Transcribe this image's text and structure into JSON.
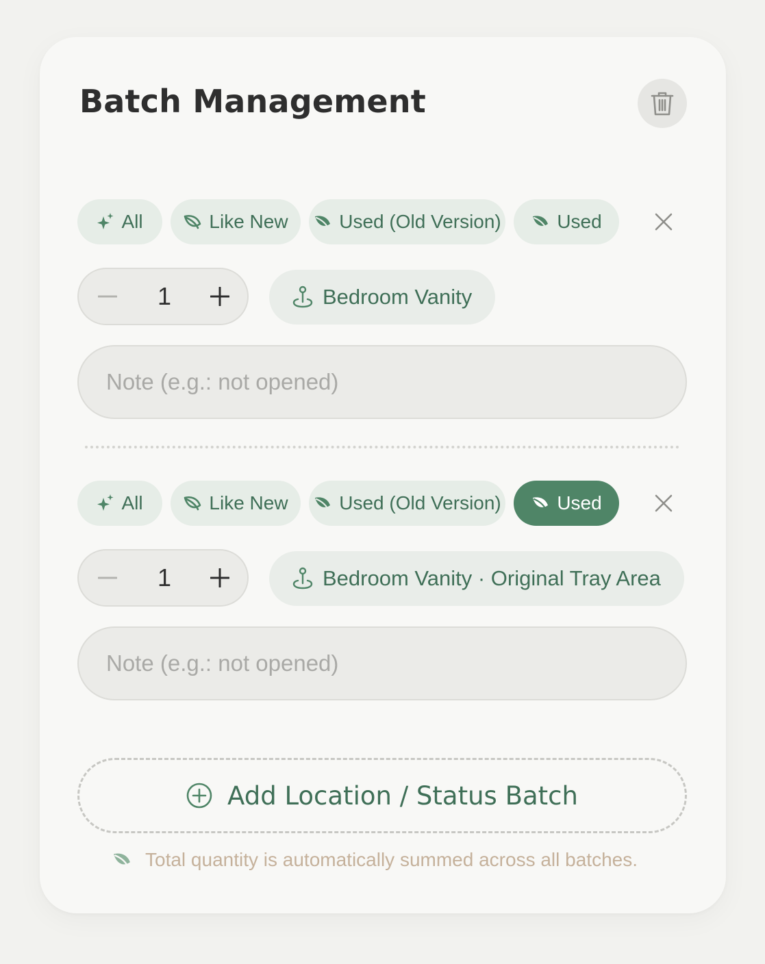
{
  "title": "Batch Management",
  "status_options": {
    "all": "All",
    "like_new": "Like New",
    "used_old": "Used (Old Version)",
    "used": "Used"
  },
  "batches": [
    {
      "quantity": "1",
      "location": "Bedroom Vanity",
      "note_placeholder": "Note (e.g.: not opened)",
      "selected_status": "none"
    },
    {
      "quantity": "1",
      "location": "Bedroom Vanity · Original Tray Area",
      "note_placeholder": "Note (e.g.: not opened)",
      "selected_status": "Used"
    }
  ],
  "add_batch_label": "Add Location / Status Batch",
  "footnote": "Total quantity is automatically summed across all batches.",
  "colors": {
    "accent": "#4f8567",
    "accent_text": "#3f6f57",
    "chip_bg": "#e6ede7",
    "footnote": "#c5b19b"
  },
  "icons": {
    "all": "sparkle-icon",
    "like_new": "leaf-outline-icon",
    "used_old": "leaf-filled-icon",
    "used": "leaf-filled-icon",
    "location": "location-pin-icon",
    "delete": "trash-icon",
    "remove": "close-icon",
    "add": "plus-circle-icon"
  }
}
